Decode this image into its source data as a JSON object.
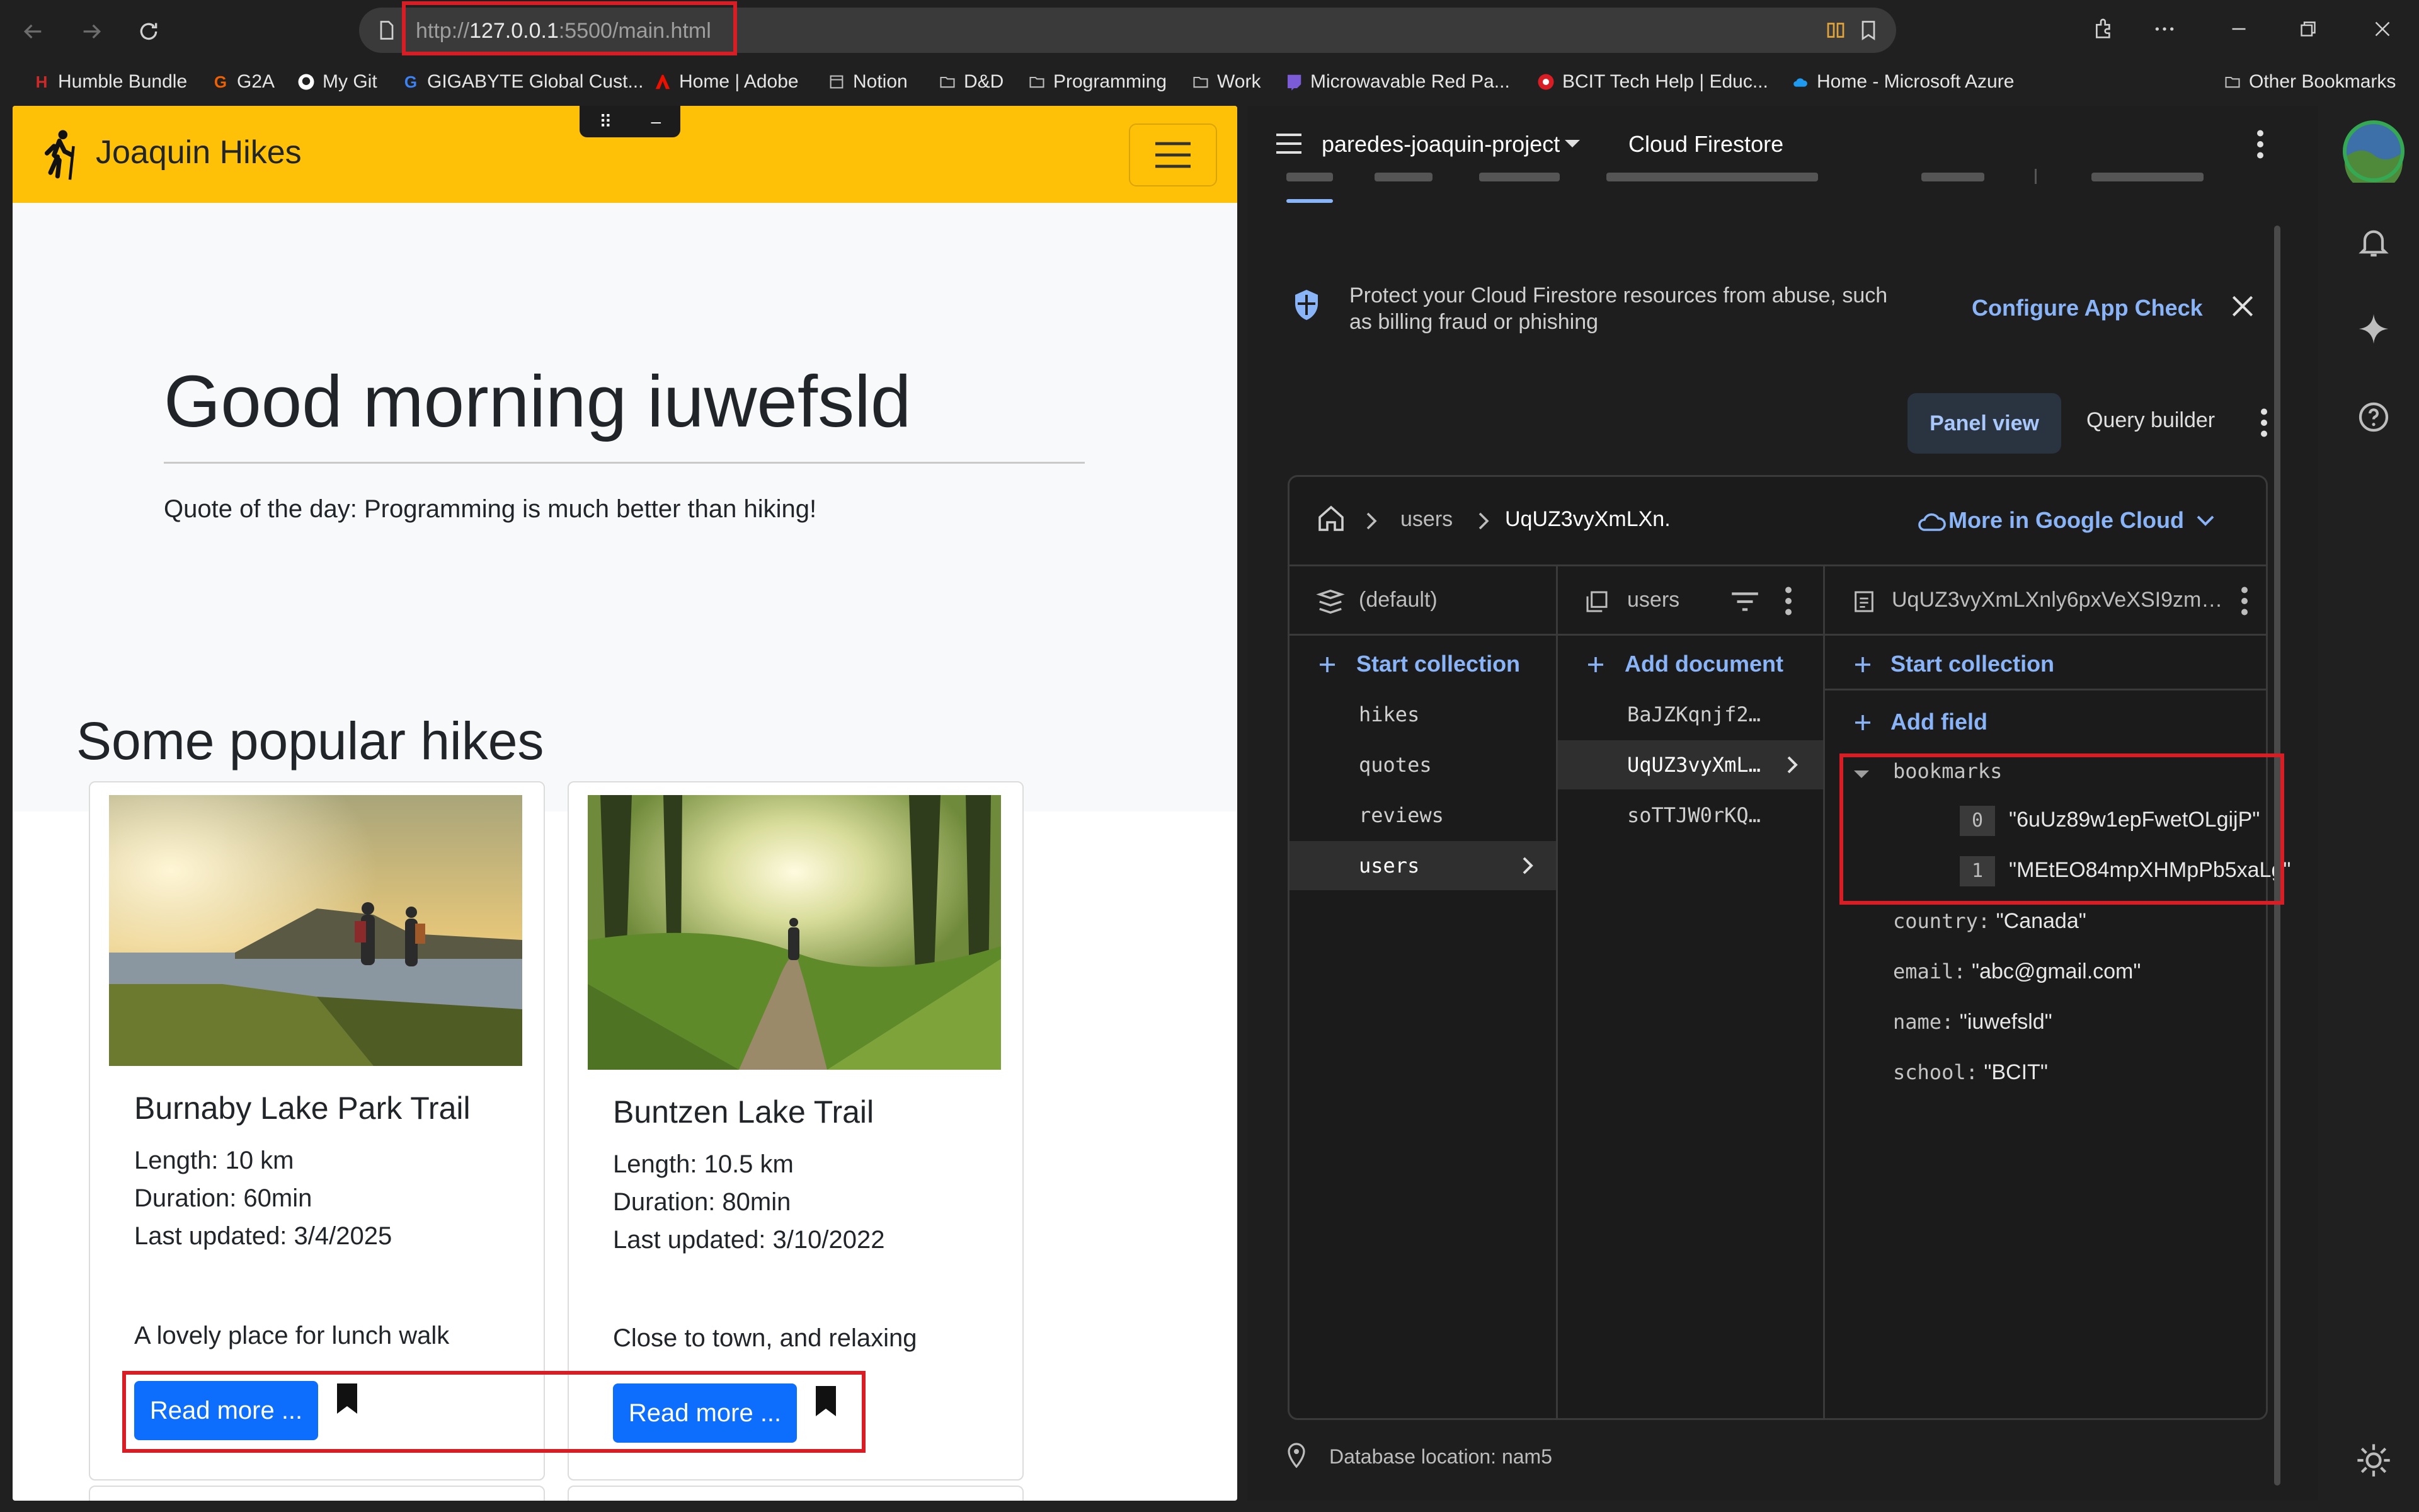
{
  "browser": {
    "url_dim_prefix": "http://",
    "url_host": "127.0.0.1",
    "url_dim_suffix": ":5500/main.html",
    "bookmarks": [
      {
        "label": "Humble Bundle",
        "icon": "humble-icon",
        "color": "#cc2929"
      },
      {
        "label": "G2A",
        "icon": "g2a-icon",
        "color": "#f05f00"
      },
      {
        "label": "My Git",
        "icon": "github-icon",
        "color": "#ffffff"
      },
      {
        "label": "GIGABYTE Global Cust...",
        "icon": "gigabyte-icon",
        "color": "#3b82f6"
      },
      {
        "label": "Home | Adobe",
        "icon": "adobe-icon",
        "color": "#eb1000"
      },
      {
        "label": "Notion",
        "icon": "notion-icon",
        "color": "#bdbdbd"
      },
      {
        "label": "D&D",
        "icon": "folder-icon",
        "color": "#bdbdbd"
      },
      {
        "label": "Programming",
        "icon": "folder-icon",
        "color": "#bdbdbd"
      },
      {
        "label": "Work",
        "icon": "folder-icon",
        "color": "#bdbdbd"
      },
      {
        "label": "Microwavable Red Pa...",
        "icon": "twitch-icon",
        "color": "#7b5cd6"
      },
      {
        "label": "BCIT Tech Help | Educ...",
        "icon": "bcit-icon",
        "color": "#d81d24"
      },
      {
        "label": "Home - Microsoft Azure",
        "icon": "azure-icon",
        "color": "#1e9bf0"
      }
    ],
    "other_bookmarks": "Other Bookmarks"
  },
  "app": {
    "brand": "Joaquin Hikes",
    "greeting": "Good morning iuwefsld",
    "quote": "Quote of the day: Programming is much better than hiking!",
    "section_heading": "Some popular hikes",
    "cards": [
      {
        "title": "Burnaby Lake Park Trail",
        "length": "Length: 10 km",
        "duration": "Duration: 60min",
        "updated": "Last updated: 3/4/2025",
        "description": "A lovely place for lunch walk",
        "button": "Read more ..."
      },
      {
        "title": "Buntzen Lake Trail",
        "length": "Length: 10.5 km",
        "duration": "Duration: 80min",
        "updated": "Last updated: 3/10/2022",
        "description": "Close to town, and relaxing",
        "button": "Read more ..."
      }
    ]
  },
  "firebase": {
    "project": "paredes-joaquin-project",
    "product": "Cloud Firestore",
    "banner_text": "Protect your Cloud Firestore resources from abuse, such as billing fraud or phishing",
    "configure_link": "Configure App Check",
    "panel_view": "Panel view",
    "query_builder": "Query builder",
    "breadcrumb": {
      "collection": "users",
      "doc": "UqUZ3vyXmLXn."
    },
    "more_cloud": "More in Google Cloud",
    "col1": {
      "header": "(default)",
      "action": "Start collection",
      "items": [
        "hikes",
        "quotes",
        "reviews",
        "users"
      ]
    },
    "col2": {
      "header": "users",
      "action": "Add document",
      "items": [
        "BaJZKqnjf2…",
        "UqUZ3vyXmL…",
        "soTTJW0rKQ…"
      ]
    },
    "col3": {
      "header": "UqUZ3vyXmLXnly6pxVeXSI9zm…",
      "action_collection": "Start collection",
      "action_field": "Add field",
      "bookmarks_key": "bookmarks",
      "bookmarks": [
        {
          "index": "0",
          "value": "\"6uUz89w1epFwetOLgijP\""
        },
        {
          "index": "1",
          "value": "\"MEtEO84mpXHMpPb5xaLg\""
        }
      ],
      "fields": [
        {
          "key": "country:",
          "value": "\"Canada\""
        },
        {
          "key": "email:",
          "value": "\"abc@gmail.com\""
        },
        {
          "key": "name:",
          "value": "\"iuwefsld\""
        },
        {
          "key": "school:",
          "value": "\"BCIT\""
        }
      ]
    },
    "db_location": "Database location: nam5"
  },
  "colors": {
    "navbar": "#ffc107",
    "primary_button": "#0d6efd",
    "highlight_box": "#d81d24",
    "firebase_link": "#8ab4f8"
  }
}
